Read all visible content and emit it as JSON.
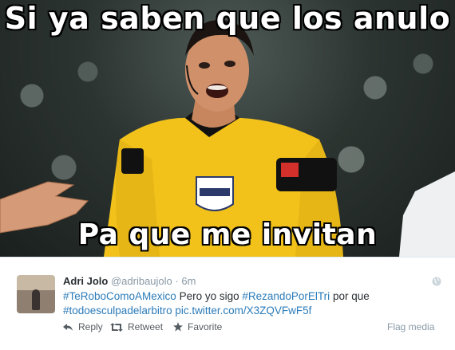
{
  "meme": {
    "top_text": "Si ya saben que los anulo",
    "bottom_text": "Pa que me invitan"
  },
  "tweet": {
    "name": "Adri Jolo",
    "handle": "@adribaujolo",
    "separator": "·",
    "time": "6m",
    "text": [
      {
        "t": "#TeRoboComoAMexico",
        "tag": true
      },
      {
        "t": " Pero yo sigo ",
        "tag": false
      },
      {
        "t": "#RezandoPorElTri",
        "tag": true
      },
      {
        "t": " por que ",
        "tag": false
      },
      {
        "t": "#todoesculpadelarbitro",
        "tag": true
      },
      {
        "t": " ",
        "tag": false
      },
      {
        "t": "pic.twitter.com/X3ZQVFwF5f",
        "tag": true
      }
    ],
    "actions": {
      "reply": "Reply",
      "retweet": "Retweet",
      "favorite": "Favorite",
      "flag": "Flag media"
    }
  },
  "colors": {
    "link": "#2b7bb9",
    "meta": "#8899a6",
    "jersey": "#f2c21b"
  },
  "icons": [
    "globe-icon",
    "reply-icon",
    "retweet-icon",
    "star-icon"
  ]
}
